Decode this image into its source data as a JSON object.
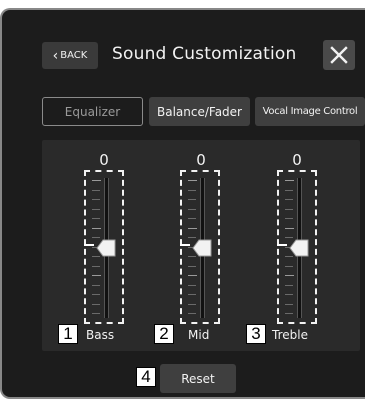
{
  "header": {
    "back_label": "BACK",
    "title": "Sound Customization"
  },
  "tabs": [
    {
      "label": "Equalizer",
      "state": "inactive"
    },
    {
      "label": "Balance/Fader",
      "state": "available"
    },
    {
      "label": "Vocal Image Control",
      "state": "available"
    }
  ],
  "sliders": [
    {
      "value": "0",
      "label": "Bass",
      "callout": "1",
      "level": 0.5
    },
    {
      "value": "0",
      "label": "Mid",
      "callout": "2",
      "level": 0.5
    },
    {
      "value": "0",
      "label": "Treble",
      "callout": "3",
      "level": 0.5
    }
  ],
  "reset": {
    "label": "Reset",
    "callout": "4"
  },
  "colors": {
    "background": "#1c1c1c",
    "panel": "#2a2a2a",
    "button": "#3f3f3f",
    "text": "#f2f2f2",
    "inactive_text": "#9a9a9a"
  }
}
